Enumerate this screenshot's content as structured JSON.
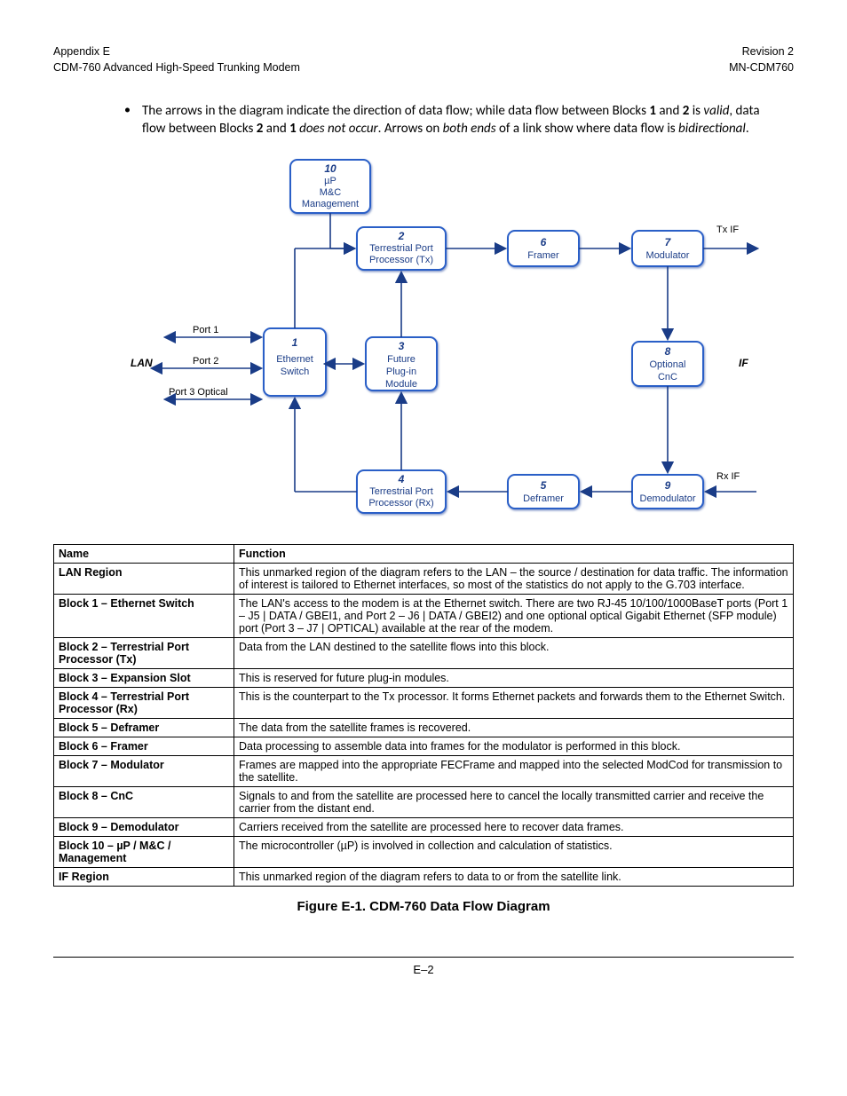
{
  "header": {
    "left1": "Appendix E",
    "left2": "CDM-760 Advanced High-Speed Trunking Modem",
    "right1": "Revision 2",
    "right2": "MN-CDM760"
  },
  "bullet": {
    "pre": "The arrows in the diagram indicate the direction of data flow; while data flow between Blocks ",
    "b1": "1",
    "mid1": " and ",
    "b2": "2",
    "mid2": " is ",
    "i1": "valid",
    "mid3": ", data flow between Blocks ",
    "b3": "2",
    "mid4": " and ",
    "b4": "1",
    "mid5": " ",
    "i2": "does not occur",
    "mid6": ". Arrows on ",
    "i3": "both ends",
    "mid7": " of a link show where data flow is ",
    "i4": "bidirectional",
    "end": "."
  },
  "diagram": {
    "lan": "LAN",
    "if": "IF",
    "port1": "Port 1",
    "port2": "Port 2",
    "port3": "Port 3 Optical",
    "txif": "Tx IF",
    "rxif": "Rx IF",
    "b1_n": "1",
    "b1_l1": "Ethernet",
    "b1_l2": "Switch",
    "b2_n": "2",
    "b2_l1": "Terrestrial Port",
    "b2_l2": "Processor (Tx)",
    "b3_n": "3",
    "b3_l1": "Future",
    "b3_l2": "Plug-in",
    "b3_l3": "Module",
    "b4_n": "4",
    "b4_l1": "Terrestrial Port",
    "b4_l2": "Processor (Rx)",
    "b5_n": "5",
    "b5_l1": "Deframer",
    "b6_n": "6",
    "b6_l1": "Framer",
    "b7_n": "7",
    "b7_l1": "Modulator",
    "b8_n": "8",
    "b8_l1": "Optional",
    "b8_l2": "CnC",
    "b9_n": "9",
    "b9_l1": "Demodulator",
    "b10_n": "10",
    "b10_l1": "µP",
    "b10_l2": "M&C",
    "b10_l3": "Management"
  },
  "table": {
    "hName": "Name",
    "hFunc": "Function",
    "rows": [
      {
        "name": "LAN Region",
        "func": "This unmarked region of the diagram refers to the LAN – the source / destination for data traffic. The information of interest is tailored to Ethernet interfaces, so most of the statistics do not apply to the G.703 interface."
      },
      {
        "name": "Block 1 – Ethernet Switch",
        "func": "The LAN's access to the modem is at the Ethernet switch. There are two RJ-45 10/100/1000BaseT ports (Port 1 – J5 | DATA / GBEI1, and Port 2 – J6 | DATA / GBEI2) and one optional optical Gigabit Ethernet (SFP module) port (Port 3 – J7 | OPTICAL) available at the rear of the modem."
      },
      {
        "name": "Block 2 – Terrestrial Port Processor (Tx)",
        "func": "Data from the LAN destined to the satellite flows into this block."
      },
      {
        "name": "Block 3 – Expansion Slot",
        "func": "This is reserved for future plug-in modules."
      },
      {
        "name": "Block 4 – Terrestrial Port Processor (Rx)",
        "func": "This is the counterpart to the Tx processor. It forms Ethernet packets and forwards them to the Ethernet Switch."
      },
      {
        "name": "Block 5 – Deframer",
        "func": "The data from the satellite frames is recovered."
      },
      {
        "name": "Block 6 – Framer",
        "func": "Data processing to assemble data into frames for the modulator is performed in this block."
      },
      {
        "name": "Block 7 – Modulator",
        "func": "Frames are mapped into the appropriate FECFrame and mapped into the selected ModCod for transmission to the satellite."
      },
      {
        "name": "Block 8 – CnC",
        "func": "Signals to and from the satellite are processed here to cancel the locally transmitted carrier and receive the carrier from the distant end."
      },
      {
        "name": "Block 9 – Demodulator",
        "func": "Carriers received from the satellite are processed here to recover data frames."
      },
      {
        "name": "Block 10 – µP / M&C / Management",
        "func": "The microcontroller (µP) is involved in collection and calculation of statistics."
      },
      {
        "name": "IF Region",
        "func": "This unmarked region of the diagram refers to data to or from the satellite link."
      }
    ]
  },
  "figureCaption": "Figure E-1. CDM-760 Data Flow Diagram",
  "pageNum": "E–2"
}
